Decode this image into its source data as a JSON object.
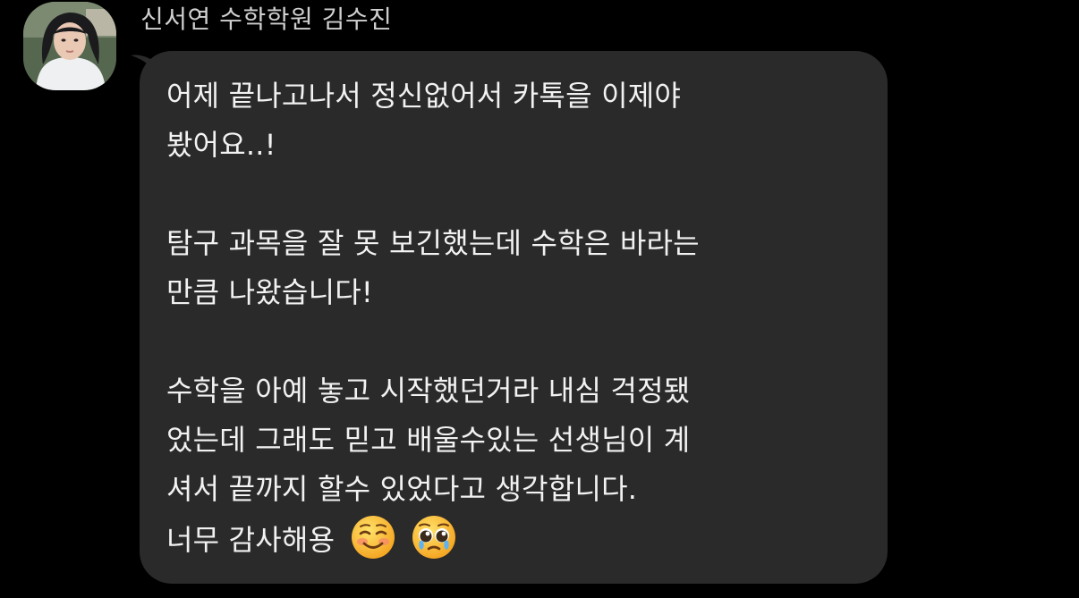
{
  "sender": {
    "name": "신서연 수학학원 김수진"
  },
  "message": {
    "lines": [
      "어제 끝나고나서 정신없어서 카톡을 이제야",
      "봤어요..!",
      "",
      "탐구 과목을 잘 못 보긴했는데 수학은 바라는",
      "만큼 나왔습니다!",
      "",
      "수학을 아예 놓고 시작했던거라 내심 걱정됐",
      "었는데 그래도 믿고 배울수있는 선생님이 계",
      "셔서 끝까지 할수 있었다고 생각합니다.",
      "너무 감사해용"
    ],
    "emojis": [
      "smiling-face-icon",
      "pleading-face-icon"
    ]
  },
  "colors": {
    "background": "#000000",
    "bubble": "#2a2a2a",
    "text": "#f2f2f2",
    "name": "#cfcfcf"
  }
}
